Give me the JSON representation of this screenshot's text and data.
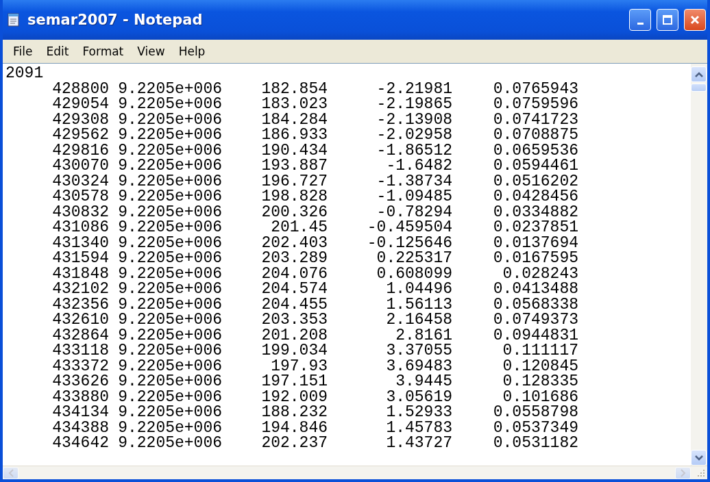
{
  "window": {
    "title": "semar2007 - Notepad"
  },
  "menu": [
    "File",
    "Edit",
    "Format",
    "View",
    "Help"
  ],
  "header_line": "2091",
  "rows": [
    [
      "428800",
      "9.2205e+006",
      "182.854",
      "-2.21981",
      "0.0765943"
    ],
    [
      "429054",
      "9.2205e+006",
      "183.023",
      "-2.19865",
      "0.0759596"
    ],
    [
      "429308",
      "9.2205e+006",
      "184.284",
      "-2.13908",
      "0.0741723"
    ],
    [
      "429562",
      "9.2205e+006",
      "186.933",
      "-2.02958",
      "0.0708875"
    ],
    [
      "429816",
      "9.2205e+006",
      "190.434",
      "-1.86512",
      "0.0659536"
    ],
    [
      "430070",
      "9.2205e+006",
      "193.887",
      "-1.6482",
      "0.0594461"
    ],
    [
      "430324",
      "9.2205e+006",
      "196.727",
      "-1.38734",
      "0.0516202"
    ],
    [
      "430578",
      "9.2205e+006",
      "198.828",
      "-1.09485",
      "0.0428456"
    ],
    [
      "430832",
      "9.2205e+006",
      "200.326",
      "-0.78294",
      "0.0334882"
    ],
    [
      "431086",
      "9.2205e+006",
      "201.45",
      "-0.459504",
      "0.0237851"
    ],
    [
      "431340",
      "9.2205e+006",
      "202.403",
      "-0.125646",
      "0.0137694"
    ],
    [
      "431594",
      "9.2205e+006",
      "203.289",
      "0.225317",
      "0.0167595"
    ],
    [
      "431848",
      "9.2205e+006",
      "204.076",
      "0.608099",
      "0.028243"
    ],
    [
      "432102",
      "9.2205e+006",
      "204.574",
      "1.04496",
      "0.0413488"
    ],
    [
      "432356",
      "9.2205e+006",
      "204.455",
      "1.56113",
      "0.0568338"
    ],
    [
      "432610",
      "9.2205e+006",
      "203.353",
      "2.16458",
      "0.0749373"
    ],
    [
      "432864",
      "9.2205e+006",
      "201.208",
      "2.8161",
      "0.0944831"
    ],
    [
      "433118",
      "9.2205e+006",
      "199.034",
      "3.37055",
      "0.111117"
    ],
    [
      "433372",
      "9.2205e+006",
      "197.93",
      "3.69483",
      "0.120845"
    ],
    [
      "433626",
      "9.2205e+006",
      "197.151",
      "3.9445",
      "0.128335"
    ],
    [
      "433880",
      "9.2205e+006",
      "192.009",
      "3.05619",
      "0.101686"
    ],
    [
      "434134",
      "9.2205e+006",
      "188.232",
      "1.52933",
      "0.0558798"
    ],
    [
      "434388",
      "9.2205e+006",
      "194.846",
      "1.45783",
      "0.0537349"
    ],
    [
      "434642",
      "9.2205e+006",
      "202.237",
      "1.43727",
      "0.0531182"
    ]
  ]
}
